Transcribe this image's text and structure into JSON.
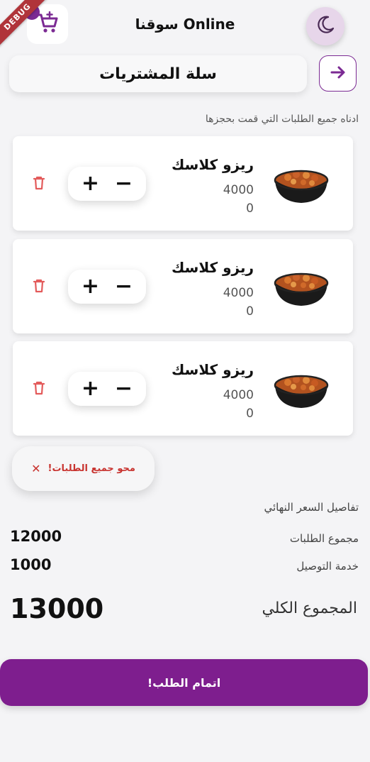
{
  "app": {
    "debug_badge": "DEBUG",
    "title": "سوقنا Online",
    "page_title": "سلة المشتريات",
    "subtitle": "ادناه جميع الطلبات التي قمت بحجزها"
  },
  "cart": {
    "items": [
      {
        "name": "ريزو كلاسك",
        "price": "4000",
        "quantity": "0"
      },
      {
        "name": "ريزو كلاسك",
        "price": "4000",
        "quantity": "0"
      },
      {
        "name": "ريزو كلاسك",
        "price": "4000",
        "quantity": "0"
      }
    ],
    "stepper": {
      "plus": "+",
      "minus": "−"
    },
    "clear_all_label": "محو جميع الطلبات!",
    "clear_all_icon": "✕"
  },
  "summary": {
    "title": "تفاصيل السعر النهائي",
    "orders_total_label": "مجموع الطلبات",
    "orders_total_value": "12000",
    "delivery_label": "خدمة التوصيل",
    "delivery_value": "1000",
    "grand_total_label": "المجموع الكلي",
    "grand_total_value": "13000"
  },
  "checkout": {
    "label": "اتمام الطلب!"
  },
  "icons": {
    "logo": "cart-logo-icon",
    "theme": "moon-icon",
    "back": "arrow-right-icon",
    "delete": "trash-icon",
    "food": "food-bowl-icon"
  },
  "colors": {
    "accent": "#7e1e8e",
    "danger": "#c8332f",
    "background": "#f4f4f6"
  }
}
